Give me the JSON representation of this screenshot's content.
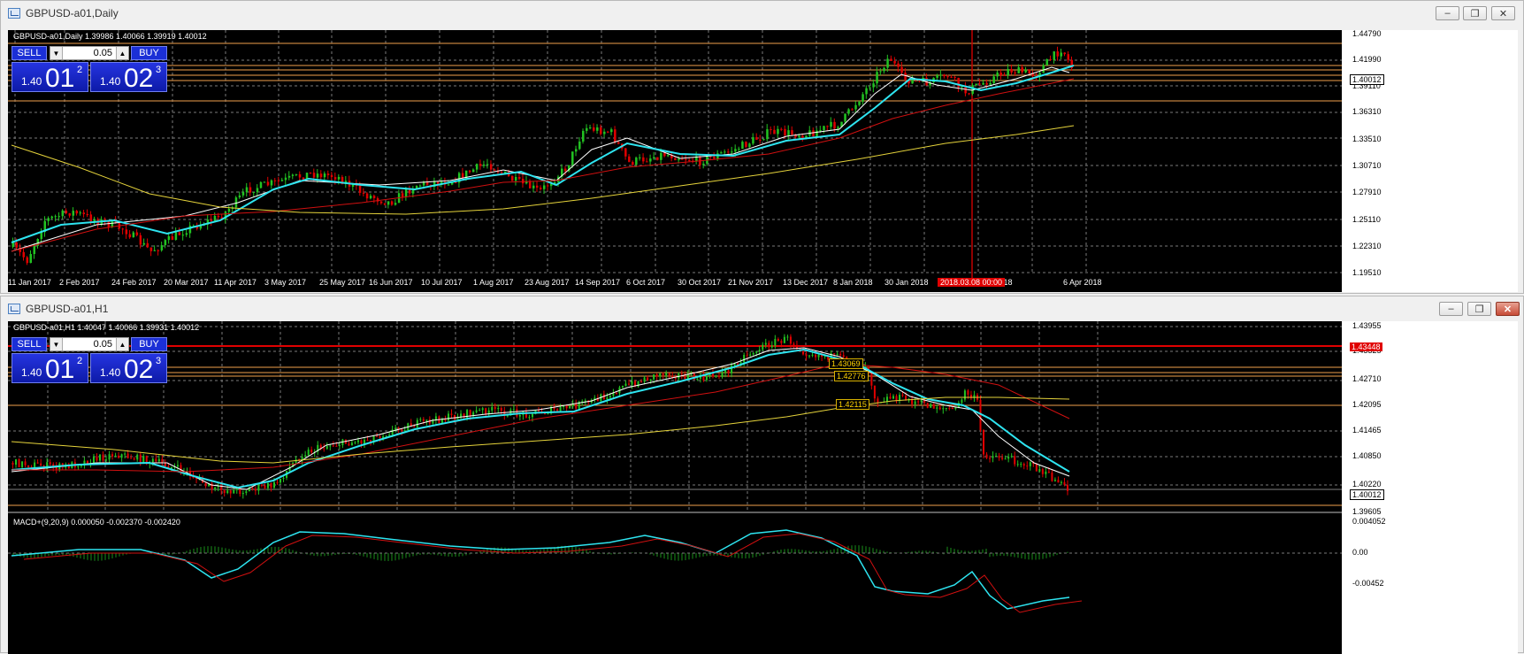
{
  "windows": [
    {
      "title": "GBPUSD-a01,Daily",
      "header": "GBPUSD-a01,Daily  1.39986 1.40066 1.39919 1.40012",
      "trade": {
        "sell": "SELL",
        "buy": "BUY",
        "lot": "0.05",
        "bid_small": "1.40",
        "bid_big": "01",
        "bid_sup": "2",
        "ask_small": "1.40",
        "ask_big": "02",
        "ask_sup": "3"
      },
      "yticks": [
        "1.44790",
        "1.41990",
        "1.39110",
        "1.36310",
        "1.33510",
        "1.30710",
        "1.27910",
        "1.25110",
        "1.22310",
        "1.19510"
      ],
      "current_price": "1.40012",
      "xticks": [
        "11 Jan 2017",
        "2 Feb 2017",
        "24 Feb 2017",
        "20 Mar 2017",
        "11 Apr 2017",
        "3 May 2017",
        "25 May 2017",
        "16 Jun 2017",
        "10 Jul 2017",
        "1 Aug 2017",
        "23 Aug 2017",
        "14 Sep 2017",
        "6 Oct 2017",
        "30 Oct 2017",
        "21 Nov 2017",
        "13 Dec 2017",
        "8 Jan 2018",
        "30 Jan 2018",
        "ar 2018",
        "6 Apr 2018"
      ],
      "time_cursor": "2018.03.08 00:00",
      "buttons": {
        "minimize": "–",
        "restore": "❐",
        "close": "✕"
      }
    },
    {
      "title": "GBPUSD-a01,H1",
      "header": "GBPUSD-a01,H1  1.40047 1.40066 1.39931 1.40012",
      "trade": {
        "sell": "SELL",
        "buy": "BUY",
        "lot": "0.05",
        "bid_small": "1.40",
        "bid_big": "01",
        "bid_sup": "2",
        "ask_small": "1.40",
        "ask_big": "02",
        "ask_sup": "3"
      },
      "yticks": [
        "1.43955",
        "1.43325",
        "1.42710",
        "1.42095",
        "1.41465",
        "1.40850",
        "1.40220",
        "1.39605"
      ],
      "current_price": "1.40012",
      "red_level": "1.43448",
      "level_labels": [
        "1.43069",
        "1.42776",
        "1.42115"
      ],
      "macd_header": "MACD+(9,20,9) 0.000050 -0.002370 -0.002420",
      "macd_yticks": [
        "0.004052",
        "0.00",
        "-0.00452"
      ],
      "buttons": {
        "minimize": "–",
        "restore": "❐",
        "close": "✕"
      }
    }
  ],
  "colors": {
    "bull": "#22c322",
    "bear": "#e00000",
    "ma_fast": "#ffffff",
    "ma_mid": "#2ee4f0",
    "ma_slow": "#d01010",
    "ma_long": "#e5d33b",
    "grid": "#7a7a7a",
    "hline": "#f0a04b"
  }
}
